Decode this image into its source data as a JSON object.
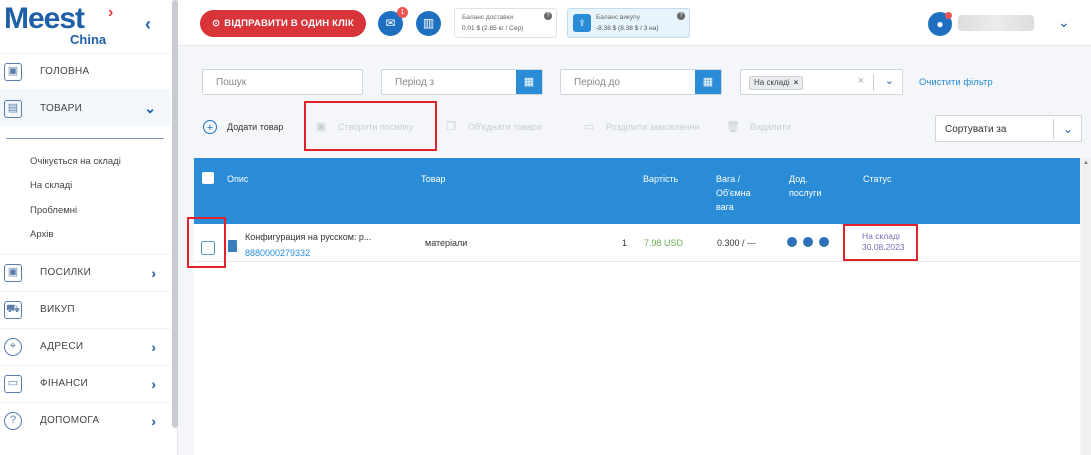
{
  "brand": {
    "name": "Meest",
    "sub": "China"
  },
  "sidebar": {
    "items": [
      {
        "label": "ГОЛОВНА",
        "icon": "home-icon"
      },
      {
        "label": "ТОВАРИ",
        "icon": "box-icon"
      },
      {
        "label": "ПОСИЛКИ",
        "icon": "parcel-icon"
      },
      {
        "label": "ВИКУП",
        "icon": "cart-icon"
      },
      {
        "label": "АДРЕСИ",
        "icon": "location-icon"
      },
      {
        "label": "ФІНАНСИ",
        "icon": "wallet-icon"
      },
      {
        "label": "ДОПОМОГА",
        "icon": "help-icon"
      }
    ],
    "submenu": [
      "Очікується на складі",
      "На складі",
      "Проблемні",
      "Архів"
    ]
  },
  "topbar": {
    "send_label": "ВІДПРАВИТИ В ОДИН КЛІК",
    "mail_badge": "1",
    "balance_delivery": {
      "title": "Баланс доставки",
      "value": "0.01 $ (2.85 кг / Сер)"
    },
    "balance_buyout": {
      "title": "Баланс викупу",
      "value": "-8.38 $ (8.38 $ / 3 на)"
    }
  },
  "filters": {
    "search_placeholder": "Пошук",
    "period_from_placeholder": "Період з",
    "period_to_placeholder": "Період до",
    "status_tag": "На складі",
    "clear_label": "Очистити фільтр"
  },
  "toolbar": {
    "add_label": "Додати товар",
    "create_label": "Створити посилку",
    "combine_label": "Об'єднати товари",
    "split_label": "Розділити замовлення",
    "delete_label": "Видалити",
    "sort_label": "Сортувати за"
  },
  "table": {
    "headers": {
      "description": "Опис",
      "product": "Товар",
      "price": "Вартість",
      "weight_line1": "Вага /",
      "weight_line2": "Об'ємна",
      "weight_line3": "вага",
      "services_line1": "Дод.",
      "services_line2": "послуги",
      "status": "Статус"
    },
    "rows": [
      {
        "description": "Конфигурация на русском: р...",
        "tracking": "8880000279332",
        "product": "матеріали",
        "qty": "1",
        "price": "7.98 USD",
        "weight": "0.300 / ---",
        "status": "На складі",
        "status_date": "30.08.2023"
      }
    ]
  },
  "colors": {
    "primary": "#2a8bd6",
    "accent": "#d9343a",
    "annotation": "#e0232b"
  }
}
